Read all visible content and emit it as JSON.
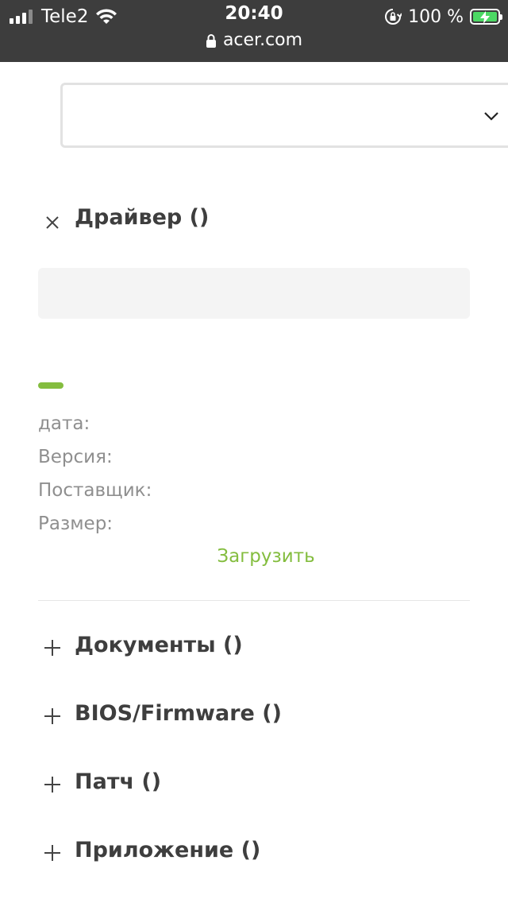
{
  "status_bar": {
    "carrier": "Tele2",
    "time": "20:40",
    "battery": "100 %",
    "url": "acer.com"
  },
  "select": {
    "value": ""
  },
  "driver_section": {
    "title": "Драйвер ()",
    "search_value": "",
    "fields": {
      "date_label": "дата:",
      "version_label": "Версия:",
      "vendor_label": "Поставщик:",
      "size_label": "Размер:"
    },
    "download_label": "Загрузить"
  },
  "collapsed_sections": [
    {
      "title": "Документы ()"
    },
    {
      "title": "BIOS/Firmware ()"
    },
    {
      "title": "Патч ()"
    },
    {
      "title": "Приложение ()"
    }
  ],
  "colors": {
    "accent": "#84bd3f",
    "status_bar": "#3d3d3d"
  },
  "icons": [
    "signal-icon",
    "wifi-icon",
    "rotation-lock-icon",
    "battery-icon",
    "lock-icon",
    "chevron-down-icon",
    "close-icon",
    "plus-icon"
  ]
}
